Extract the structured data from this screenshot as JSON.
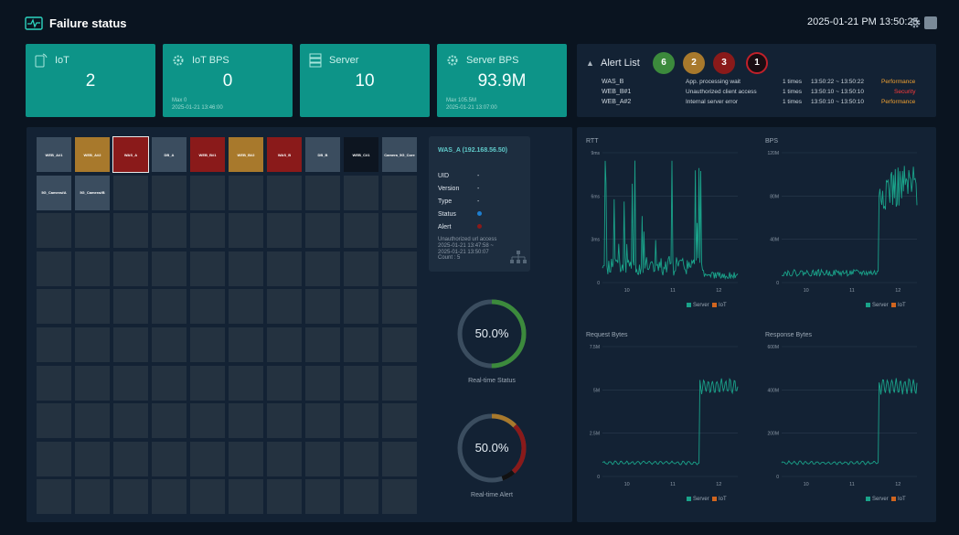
{
  "header": {
    "title": "Failure status",
    "clock": "2025-01-21 PM 13:50:25"
  },
  "kpis": [
    {
      "label": "IoT",
      "value": "2",
      "sub1": "",
      "sub2": "",
      "icon": "phone-signal-icon"
    },
    {
      "label": "IoT BPS",
      "value": "0",
      "sub1": "Max 0",
      "sub2": "2025-01-21 13:46:00",
      "icon": "gear-chart-icon"
    },
    {
      "label": "Server",
      "value": "10",
      "sub1": "",
      "sub2": "",
      "icon": "server-icon"
    },
    {
      "label": "Server BPS",
      "value": "93.9M",
      "sub1": "Max 105.5M",
      "sub2": "2025-01-21 13:07:00",
      "icon": "gear-chart-icon"
    }
  ],
  "alerts": {
    "title": "Alert List",
    "counts": [
      {
        "value": "6",
        "color": "#3c8a3c"
      },
      {
        "value": "2",
        "color": "#a8792c"
      },
      {
        "value": "3",
        "color": "#8a1a1a"
      },
      {
        "value": "1",
        "color": "#1a0d12"
      }
    ],
    "rows": [
      {
        "name": "WAS_B",
        "message": "App. processing wait",
        "times": "1 times",
        "range": "13:50:22 ~ 13:50:22",
        "type": "Performance",
        "type_color": "#f0a030"
      },
      {
        "name": "WEB_B#1",
        "message": "Unauthorized client access",
        "times": "1 times",
        "range": "13:50:10 ~ 13:50:10",
        "type": "Security",
        "type_color": "#ff3b3b"
      },
      {
        "name": "WEB_A#2",
        "message": "Internal server error",
        "times": "1 times",
        "range": "13:50:10 ~ 13:50:10",
        "type": "Performance",
        "type_color": "#f0a030"
      }
    ]
  },
  "grid_cells": [
    {
      "label": "WEB_A#1",
      "color": "#3b4d5f"
    },
    {
      "label": "WEB_A#2",
      "color": "#a8792c"
    },
    {
      "label": "WAS_A",
      "color": "#8a1a1a"
    },
    {
      "label": "DB_A",
      "color": "#3b4d5f"
    },
    {
      "label": "WEB_B#1",
      "color": "#8a1a1a"
    },
    {
      "label": "WEB_B#2",
      "color": "#a8792c"
    },
    {
      "label": "WAS_B",
      "color": "#8a1a1a"
    },
    {
      "label": "DB_B",
      "color": "#3b4d5f"
    },
    {
      "label": "WEB_C#1",
      "color": "#0d1520"
    },
    {
      "label": "Camera_5G_Core",
      "color": "#3b4d5f"
    },
    {
      "label": "5G_Camera#A",
      "color": "#3b4d5f"
    },
    {
      "label": "5G_Camera#B",
      "color": "#3b4d5f"
    }
  ],
  "selected_node": {
    "title": "WAS_A (192.168.56.50)",
    "fields": [
      {
        "key": "UID",
        "value": "-"
      },
      {
        "key": "Version",
        "value": "-"
      },
      {
        "key": "Type",
        "value": "-"
      }
    ],
    "status_label": "Status",
    "status_color": "#1e7fd0",
    "alert_label": "Alert",
    "alert_color": "#8a1a1a",
    "note1": "Unauthorized url access",
    "note2": "2025-01-21 13:47:58 ~",
    "note3": "2025-01-21 13:50:07",
    "note4": "Count : 5"
  },
  "gauges": [
    {
      "label": "Real-time Status",
      "value": "50.0%"
    },
    {
      "label": "Real-time Alert",
      "value": "50.0%"
    }
  ],
  "legend": {
    "server": "Server",
    "iot": "IoT",
    "server_color": "#1aa38a",
    "iot_color": "#d0651f"
  },
  "chart_data": [
    {
      "type": "line",
      "title": "RTT",
      "ylabel": "",
      "y_ticks": [
        "0",
        "3ms",
        "6ms",
        "9ms"
      ],
      "x_ticks": [
        "10",
        "11",
        "12"
      ],
      "ylim": [
        0,
        9
      ],
      "series": [
        {
          "name": "Server"
        },
        {
          "name": "IoT"
        }
      ]
    },
    {
      "type": "line",
      "title": "BPS",
      "ylabel": "",
      "y_ticks": [
        "0",
        "40M",
        "80M",
        "120M"
      ],
      "x_ticks": [
        "10",
        "11",
        "12"
      ],
      "ylim": [
        0,
        120
      ],
      "series": [
        {
          "name": "Server"
        },
        {
          "name": "IoT"
        }
      ]
    },
    {
      "type": "line",
      "title": "Request Bytes",
      "ylabel": "",
      "y_ticks": [
        "0",
        "2.5M",
        "5M",
        "7.5M"
      ],
      "x_ticks": [
        "10",
        "11",
        "12"
      ],
      "ylim": [
        0,
        7.5
      ],
      "series": [
        {
          "name": "Server"
        },
        {
          "name": "IoT"
        }
      ]
    },
    {
      "type": "line",
      "title": "Response Bytes",
      "ylabel": "",
      "y_ticks": [
        "0",
        "200M",
        "400M",
        "600M"
      ],
      "x_ticks": [
        "10",
        "11",
        "12"
      ],
      "ylim": [
        0,
        600
      ],
      "series": [
        {
          "name": "Server"
        },
        {
          "name": "IoT"
        }
      ]
    }
  ]
}
